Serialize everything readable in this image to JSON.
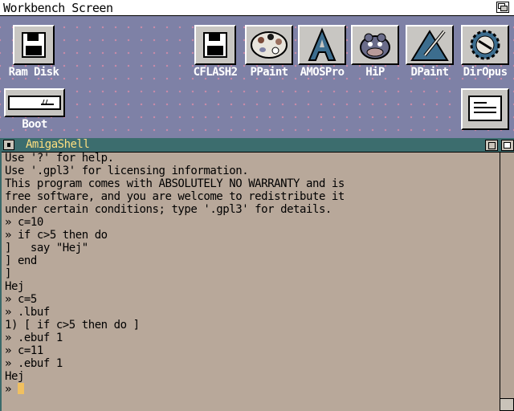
{
  "screen": {
    "title": "Workbench Screen"
  },
  "desktop": {
    "icons": [
      {
        "label": "Ram Disk",
        "icon": "floppy-disk-icon"
      },
      {
        "label": "Boot",
        "icon": "harddisk-icon"
      },
      {
        "label": "CFLASH2",
        "icon": "floppy-disk-icon"
      },
      {
        "label": "PPaint",
        "icon": "palette-icon"
      },
      {
        "label": "AMOSPro",
        "icon": "letter-a-icon"
      },
      {
        "label": "HiP",
        "icon": "hippo-icon"
      },
      {
        "label": "DPaint",
        "icon": "paintbrush-icon"
      },
      {
        "label": "DirOpus",
        "icon": "gear-globe-icon"
      },
      {
        "label": "",
        "icon": "document-icon"
      }
    ]
  },
  "shell": {
    "title": "AmigaShell",
    "lines": [
      "Use '?' for help.",
      "Use '.gpl3' for licensing information.",
      "This program comes with ABSOLUTELY NO WARRANTY and is",
      "free software, and you are welcome to redistribute it",
      "under certain conditions; type '.gpl3' for details.",
      "» c=10",
      "» if c>5 then do",
      "]   say \"Hej\"",
      "] end",
      "]",
      "Hej",
      "» c=5",
      "» .lbuf",
      "1) [ if c>5 then do ]",
      "» .ebuf 1",
      "» c=11",
      "» .ebuf 1",
      "Hej"
    ],
    "prompt": "»"
  },
  "colors": {
    "desktop": "#7e81a6",
    "shell_bg": "#b8a89a",
    "titlebar": "#3c6d6e",
    "cursor": "#f0c060"
  }
}
